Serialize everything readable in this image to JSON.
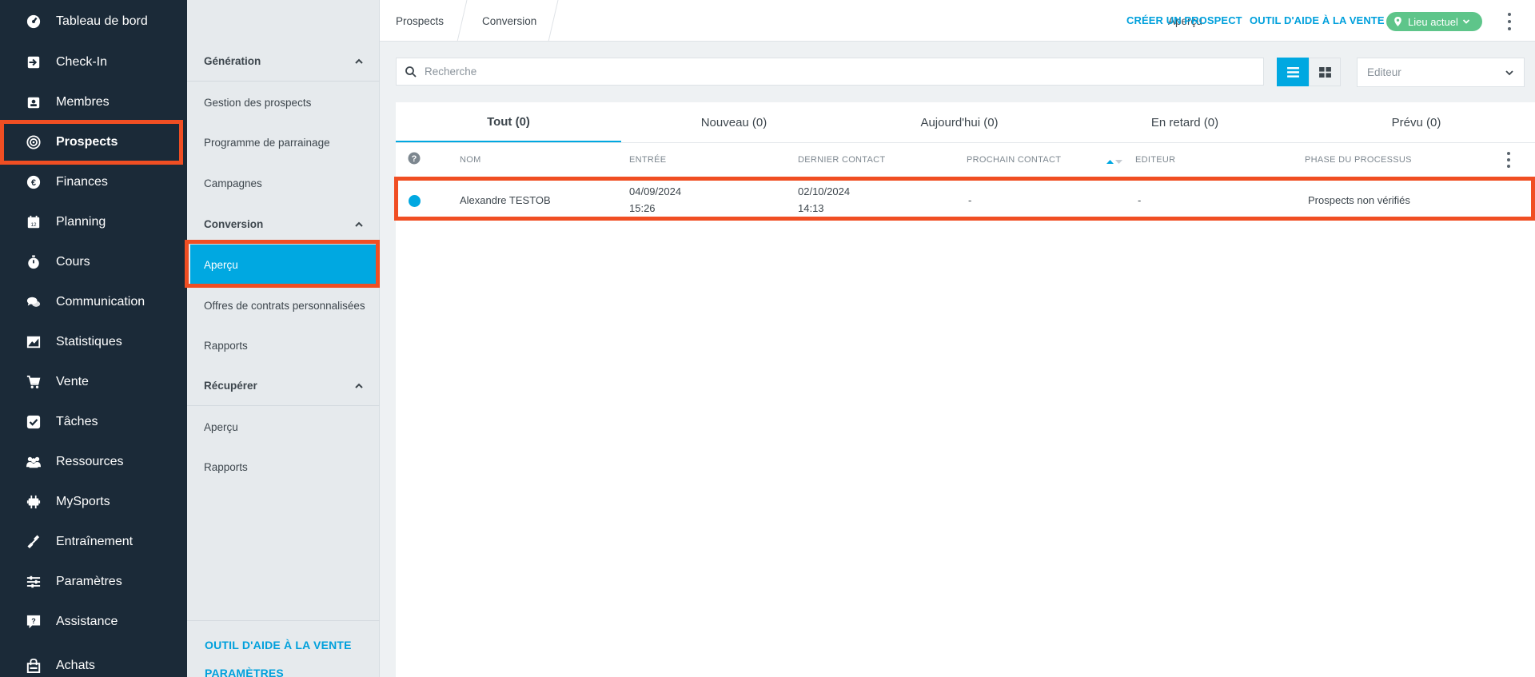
{
  "sidebar": {
    "items": [
      {
        "label": "Tableau de bord",
        "icon": "dashboard-icon"
      },
      {
        "label": "Check-In",
        "icon": "check-in-icon"
      },
      {
        "label": "Membres",
        "icon": "members-icon"
      },
      {
        "label": "Prospects",
        "icon": "prospects-icon"
      },
      {
        "label": "Finances",
        "icon": "finances-icon"
      },
      {
        "label": "Planning",
        "icon": "calendar-icon"
      },
      {
        "label": "Cours",
        "icon": "stopwatch-icon"
      },
      {
        "label": "Communication",
        "icon": "chat-icon"
      },
      {
        "label": "Statistiques",
        "icon": "chart-icon"
      },
      {
        "label": "Vente",
        "icon": "cart-icon"
      },
      {
        "label": "Tâches",
        "icon": "task-check-icon"
      },
      {
        "label": "Ressources",
        "icon": "resources-icon"
      },
      {
        "label": "MySports",
        "icon": "mysports-icon"
      },
      {
        "label": "Entraînement",
        "icon": "dumbbell-icon"
      },
      {
        "label": "Paramètres",
        "icon": "sliders-icon"
      },
      {
        "label": "Assistance",
        "icon": "help-chat-icon"
      },
      {
        "label": "Achats",
        "icon": "shopping-bag-icon"
      }
    ],
    "active": "Prospects"
  },
  "subnav": {
    "sections": [
      {
        "title": "Génération",
        "items": [
          "Gestion des prospects",
          "Programme de parrainage",
          "Campagnes"
        ]
      },
      {
        "title": "Conversion",
        "items": [
          "Aperçu",
          "Offres de contrats personnalisées",
          "Rapports"
        ]
      },
      {
        "title": "Récupérer",
        "items": [
          "Aperçu",
          "Rapports"
        ]
      }
    ],
    "active_item": "Aperçu",
    "footer": {
      "sales_tool": "OUTIL D'AIDE À LA VENTE",
      "settings": "PARAMÈTRES"
    }
  },
  "breadcrumb": [
    "Prospects",
    "Conversion",
    "Aperçu"
  ],
  "topbar": {
    "create_prospect": "CRÉER UN PROSPECT",
    "sales_tool": "OUTIL D'AIDE À LA VENTE",
    "location": "Lieu actuel"
  },
  "toolbar": {
    "search_placeholder": "Recherche",
    "editor_placeholder": "Editeur"
  },
  "tabs": [
    {
      "label": "Tout (0)",
      "active": true
    },
    {
      "label": "Nouveau (0)",
      "active": false
    },
    {
      "label": "Aujourd'hui (0)",
      "active": false
    },
    {
      "label": "En retard (0)",
      "active": false
    },
    {
      "label": "Prévu (0)",
      "active": false
    }
  ],
  "table": {
    "columns": [
      "NOM",
      "ENTRÉE",
      "DERNIER CONTACT",
      "PROCHAIN CONTACT",
      "EDITEUR",
      "PHASE DU PROCESSUS"
    ],
    "rows": [
      {
        "name": "Alexandre TESTOB",
        "entry_date": "04/09/2024",
        "entry_time": "15:26",
        "last_contact_date": "02/10/2024",
        "last_contact_time": "14:13",
        "next_contact": "-",
        "editor": "-",
        "phase": "Prospects non vérifiés"
      }
    ]
  },
  "colors": {
    "sidebar_bg": "#1b2a38",
    "accent": "#00a8e1",
    "highlight": "#f04e23",
    "location_badge": "#5ec58a"
  }
}
